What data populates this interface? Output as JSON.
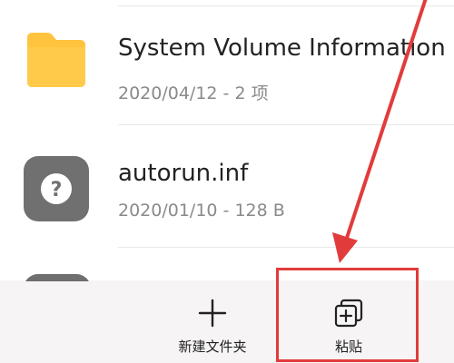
{
  "files": [
    {
      "name": "System Volume Information",
      "meta": "2020/04/12 - 2 项",
      "icon": "folder-icon"
    },
    {
      "name": "autorun.inf",
      "meta": "2020/01/10 - 128 B",
      "icon": "unknown-file-icon"
    }
  ],
  "bottom_bar": {
    "new_folder_label": "新建文件夹",
    "paste_label": "粘贴"
  },
  "colors": {
    "folder": "#FFC33D",
    "unknown_file": "#707070",
    "annotation": "#E23B3B"
  }
}
